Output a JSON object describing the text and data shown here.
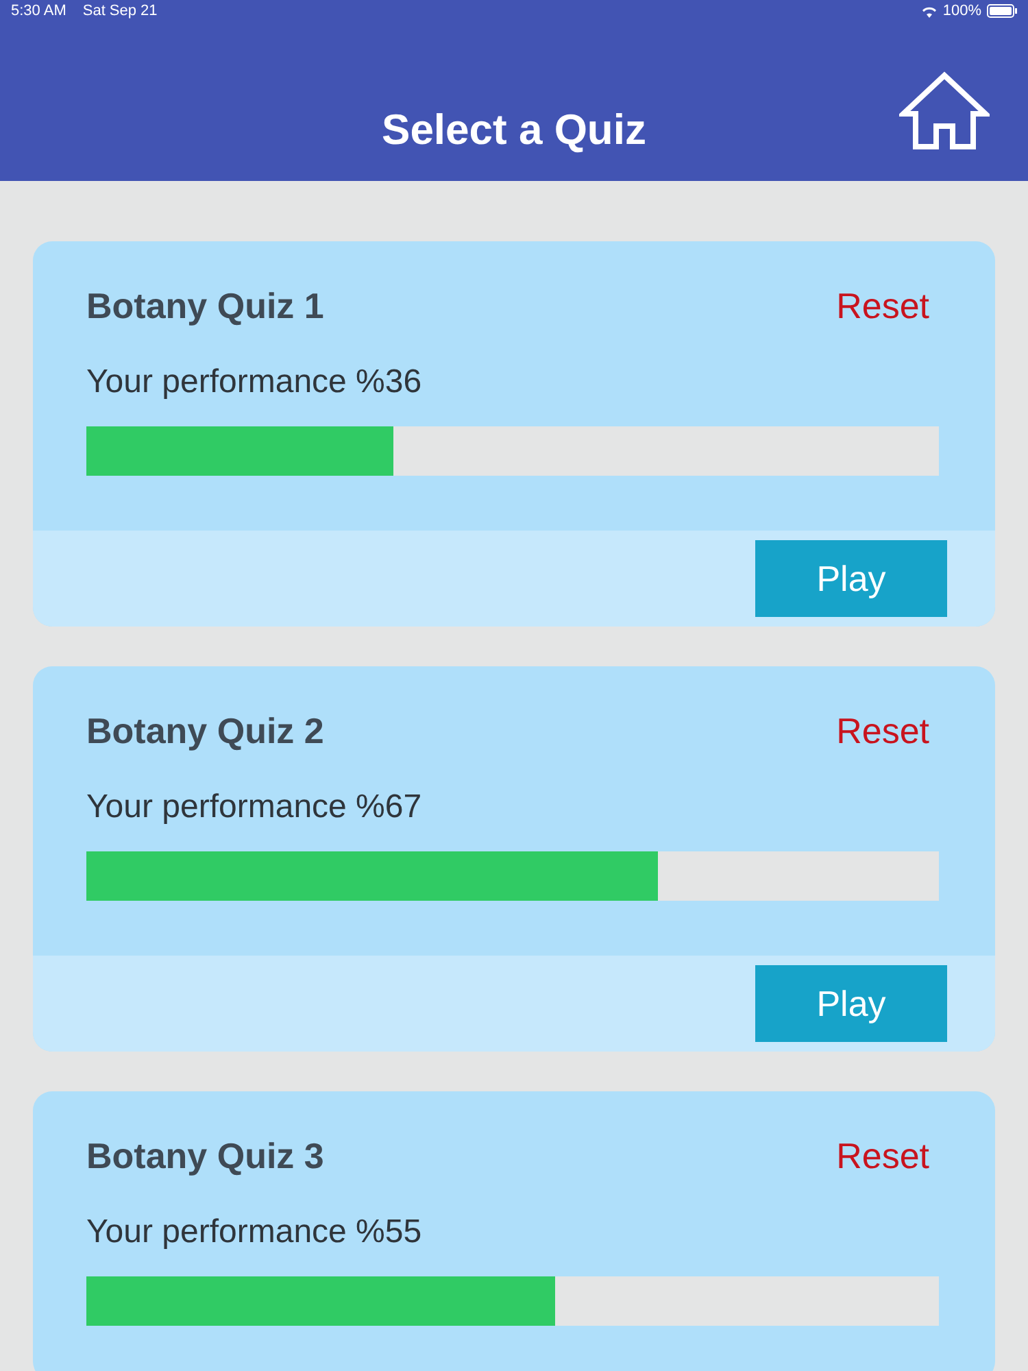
{
  "status_bar": {
    "time": "5:30 AM",
    "date": "Sat Sep 21",
    "battery": "100%"
  },
  "header": {
    "title": "Select a Quiz"
  },
  "quizzes": [
    {
      "title": "Botany Quiz 1",
      "reset": "Reset",
      "performance": "Your performance %36",
      "level": 0.36,
      "play": "Play"
    },
    {
      "title": "Botany Quiz 2",
      "reset": "Reset",
      "performance": "Your performance %67",
      "level": 0.67,
      "play": "Play"
    },
    {
      "title": "Botany Quiz 3",
      "reset": "Reset",
      "performance": "Your performance %55",
      "level": 0.55
    }
  ]
}
